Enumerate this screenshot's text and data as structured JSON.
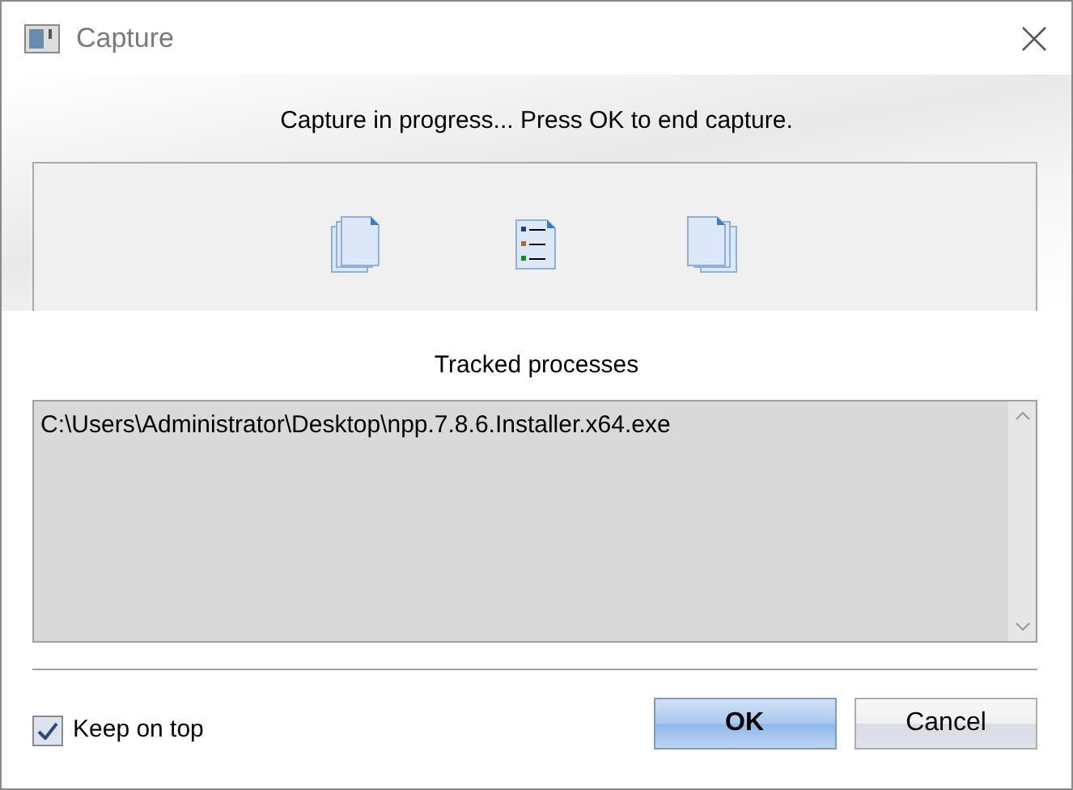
{
  "window": {
    "title": "Capture"
  },
  "message": "Capture in progress... Press OK to end capture.",
  "tracked_label": "Tracked processes",
  "processes": [
    "C:\\Users\\Administrator\\Desktop\\npp.7.8.6.Installer.x64.exe"
  ],
  "keep_on_top": {
    "label": "Keep on top",
    "checked": true
  },
  "buttons": [
    {
      "label": "OK",
      "kind": "default"
    },
    {
      "label": "Cancel",
      "kind": "normal"
    }
  ]
}
